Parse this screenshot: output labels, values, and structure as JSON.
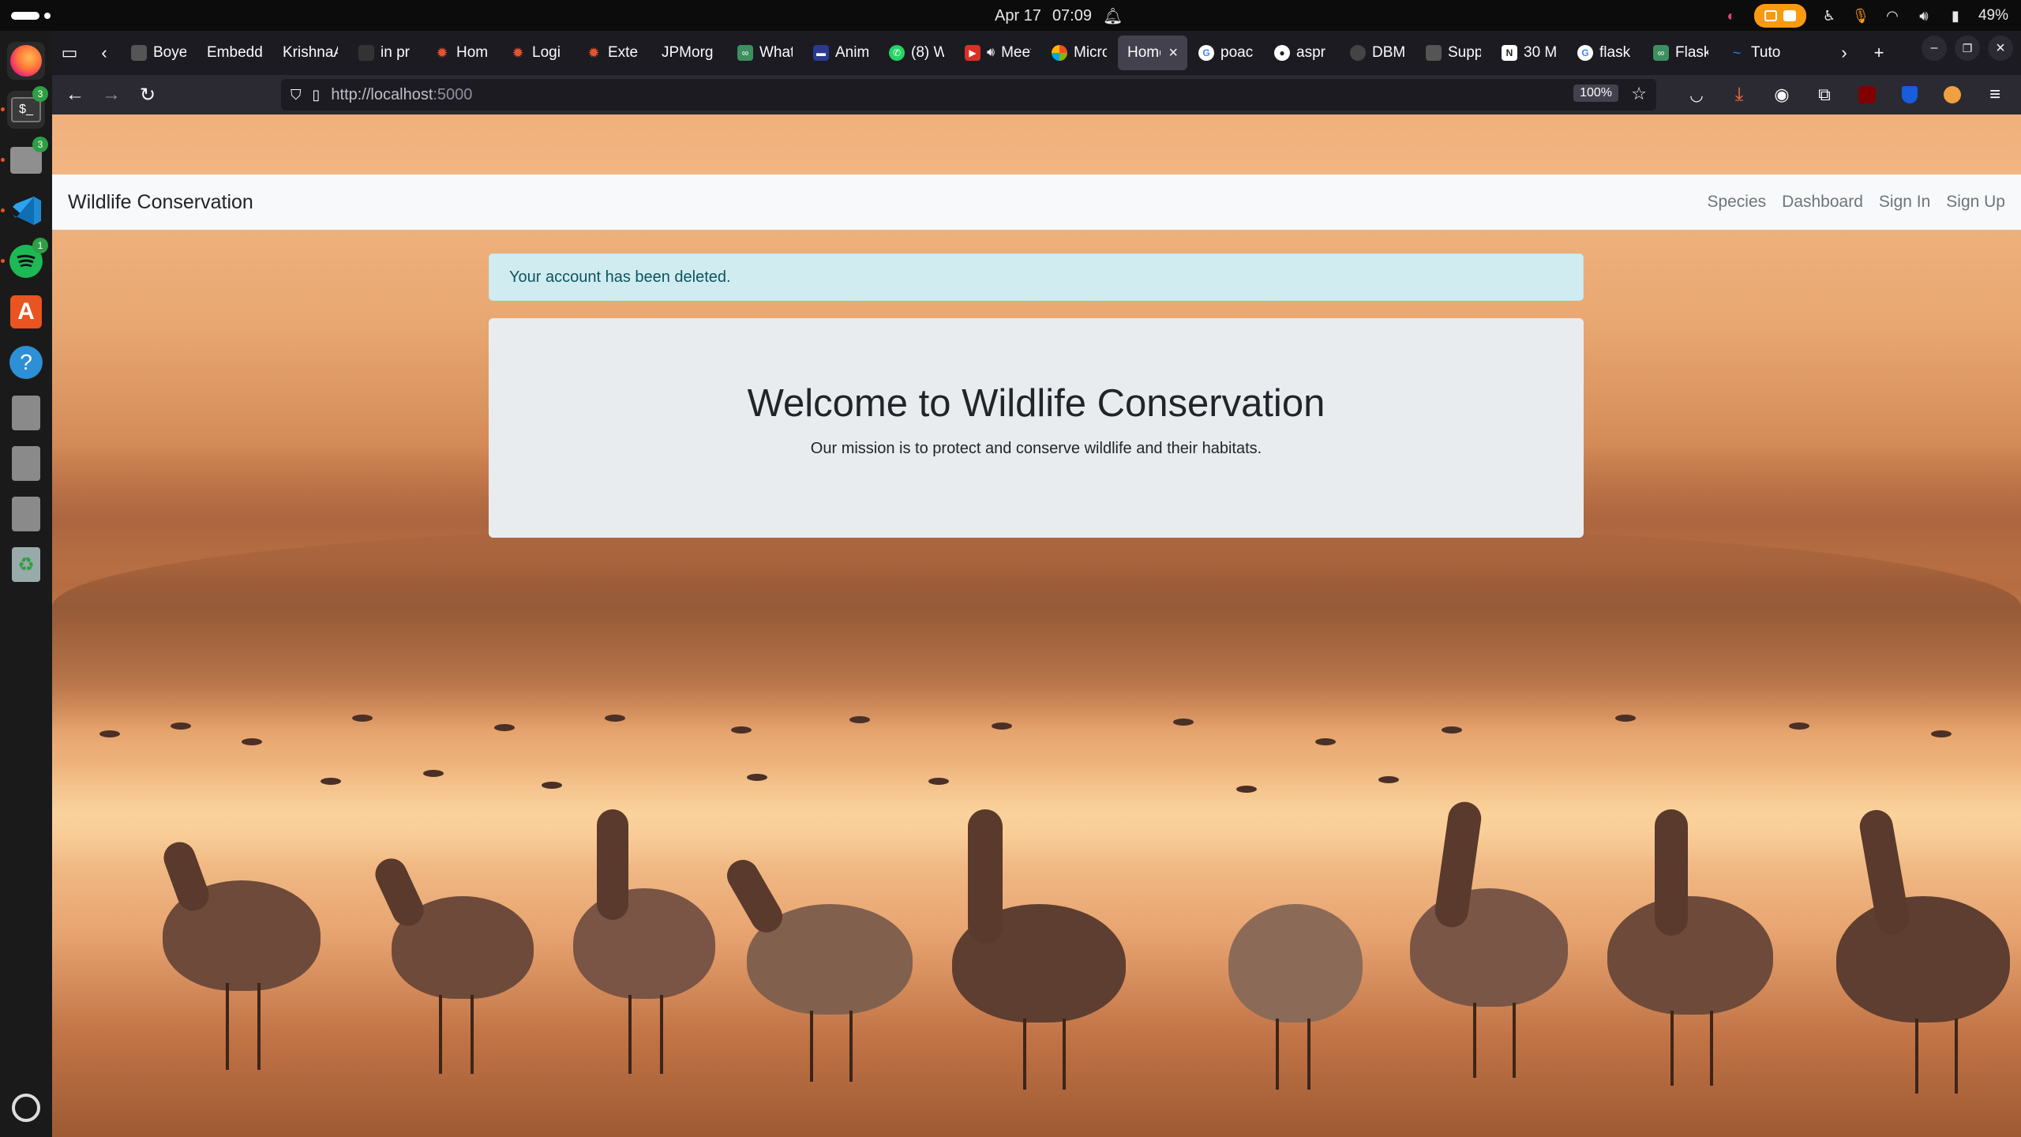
{
  "system": {
    "date": "Apr 17",
    "time": "07:09",
    "battery": "49%"
  },
  "dock": {
    "items": [
      {
        "name": "firefox"
      },
      {
        "name": "terminal",
        "badge": "3"
      },
      {
        "name": "files",
        "badge": "3"
      },
      {
        "name": "vscode"
      },
      {
        "name": "spotify",
        "badge": "1"
      },
      {
        "name": "app-center"
      },
      {
        "name": "help"
      },
      {
        "name": "drive-1"
      },
      {
        "name": "drive-2"
      },
      {
        "name": "drive-3"
      },
      {
        "name": "trash"
      },
      {
        "name": "show-apps"
      }
    ]
  },
  "browser": {
    "tabs": [
      {
        "label": "Boye",
        "color": "#555"
      },
      {
        "label": "Embedd",
        "color": ""
      },
      {
        "label": "KrishnaA",
        "color": ""
      },
      {
        "label": "in pr",
        "color": "#333"
      },
      {
        "label": "Hom",
        "color": "#e5532d"
      },
      {
        "label": "Logi",
        "color": "#e5532d"
      },
      {
        "label": "Exte",
        "color": "#e5532d"
      },
      {
        "label": "JPMorg",
        "color": ""
      },
      {
        "label": "What",
        "color": "#3d8f5f"
      },
      {
        "label": "Anim",
        "color": "#2a3a8f"
      },
      {
        "label": "(8) W",
        "color": "#25d366"
      },
      {
        "label": "Meet",
        "color": "#d93025"
      },
      {
        "label": "Micro",
        "color": "#7b61ff"
      },
      {
        "label": "Home",
        "color": "",
        "active": true
      },
      {
        "label": "poac",
        "color": "#4285f4"
      },
      {
        "label": "aspr",
        "color": "#222"
      },
      {
        "label": "DBM",
        "color": "#444"
      },
      {
        "label": "Supp",
        "color": "#555"
      },
      {
        "label": "30 M",
        "color": "#222"
      },
      {
        "label": "flask",
        "color": "#4285f4"
      },
      {
        "label": "Flask",
        "color": "#3d8f5f"
      },
      {
        "label": "Tuto",
        "color": "#1e88e5"
      }
    ],
    "url_host": "http://localhost",
    "url_port": ":5000",
    "zoom": "100%"
  },
  "site": {
    "brand": "Wildlife Conservation",
    "nav": [
      "Species",
      "Dashboard",
      "Sign In",
      "Sign Up"
    ],
    "alert": "Your account has been deleted.",
    "heading": "Welcome to Wildlife Conservation",
    "tagline": "Our mission is to protect and conserve wildlife and their habitats."
  }
}
